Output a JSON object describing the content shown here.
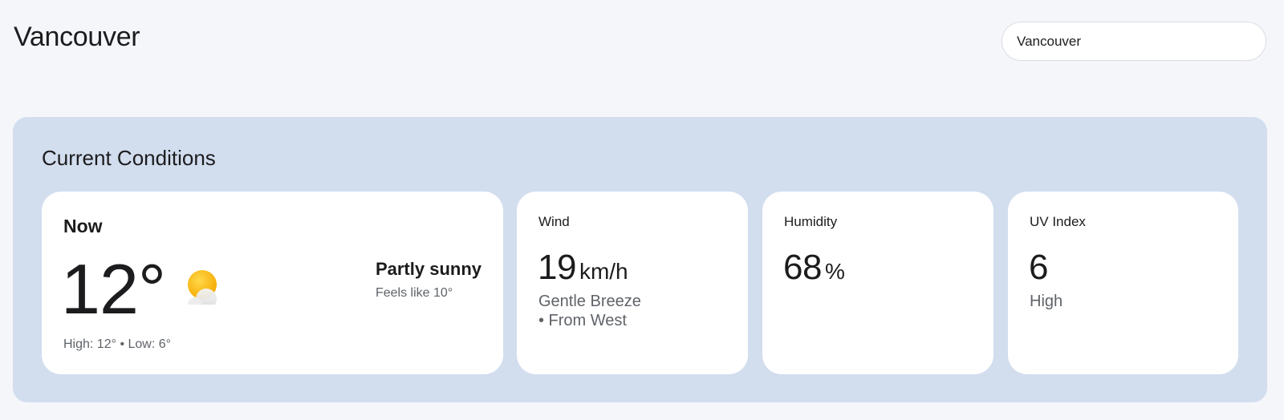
{
  "header": {
    "title": "Vancouver",
    "search_value": "Vancouver"
  },
  "conditions": {
    "section_title": "Current Conditions",
    "now": {
      "label": "Now",
      "temperature": "12°",
      "icon": "partly-sunny-icon",
      "condition": "Partly sunny",
      "feels_like": "Feels like 10°",
      "high_low": "High: 12° • Low: 6°"
    },
    "wind": {
      "label": "Wind",
      "value": "19",
      "unit": "km/h",
      "description": "Gentle Breeze",
      "direction": "• From West"
    },
    "humidity": {
      "label": "Humidity",
      "value": "68",
      "unit": "%"
    },
    "uv": {
      "label": "UV Index",
      "value": "6",
      "level": "High"
    }
  },
  "colors": {
    "page_background": "#f5f6fa",
    "panel_background": "#d2ddee",
    "card_background": "#ffffff",
    "sun_yellow": "#f9b710",
    "muted_text": "#5f6368"
  }
}
